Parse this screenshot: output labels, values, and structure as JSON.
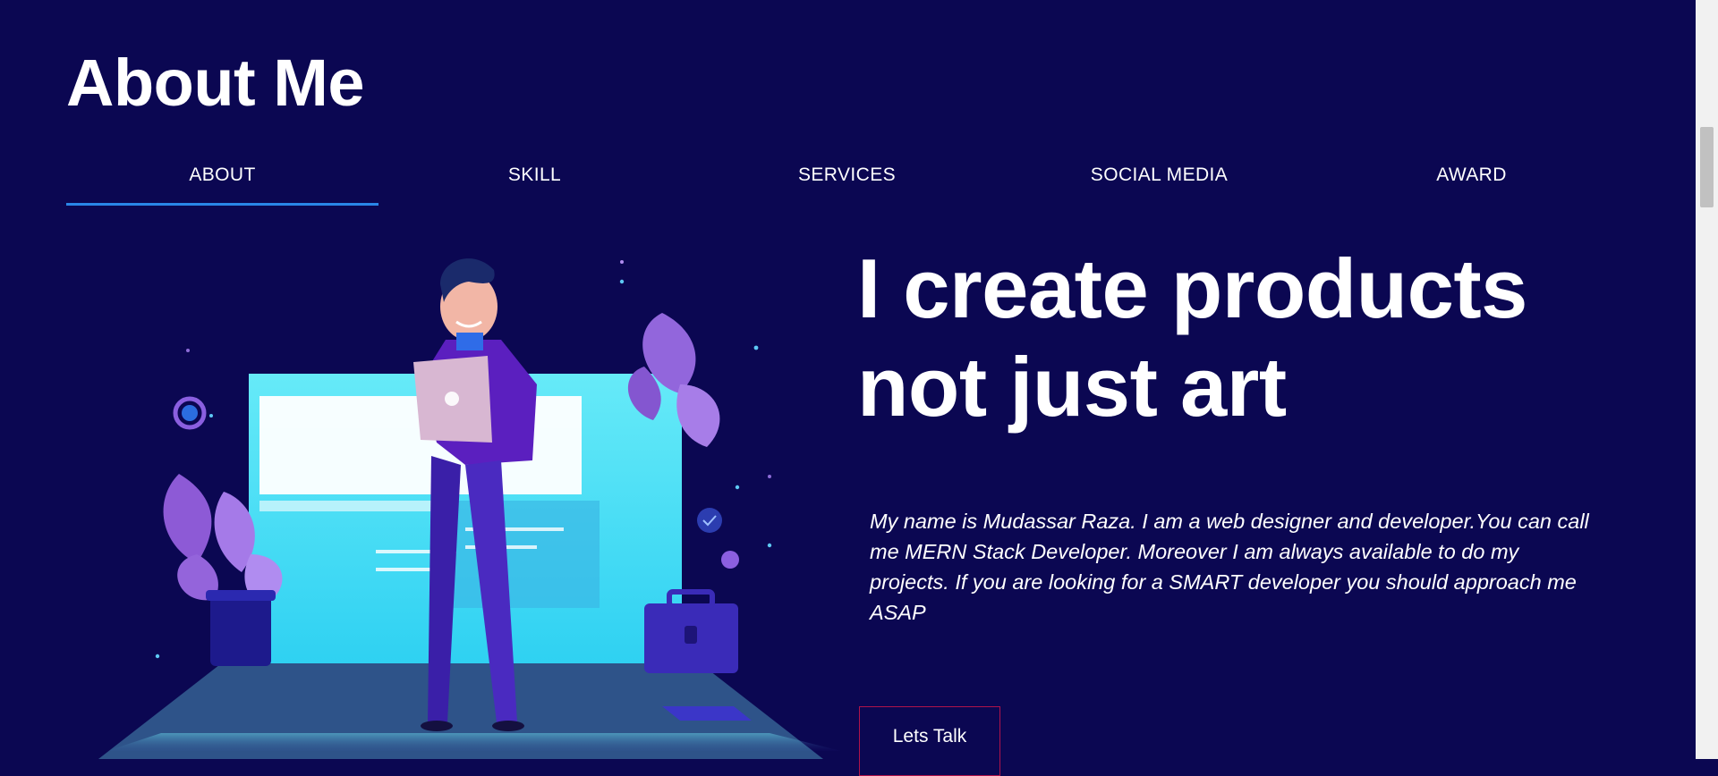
{
  "page": {
    "title": "About Me"
  },
  "tabs": [
    {
      "label": "ABOUT",
      "active": true
    },
    {
      "label": "SKILL",
      "active": false
    },
    {
      "label": "SERVICES",
      "active": false
    },
    {
      "label": "SOCIAL MEDIA",
      "active": false
    },
    {
      "label": "AWARD",
      "active": false
    }
  ],
  "hero": {
    "headline_line1": "I create products",
    "headline_line2": "not just art",
    "bio": "My name is Mudassar Raza. I am a web designer and developer.You can call me MERN Stack Developer. Moreover I am always available to do my projects. If you are looking for a SMART developer you should approach me ASAP",
    "cta_label": "Lets Talk"
  },
  "colors": {
    "background": "#0b0752",
    "tab_underline": "#2a86e8",
    "button_border": "#b0134a",
    "illustration_screen": "#5fe6f7",
    "illustration_leaves": "#8d5ad6"
  },
  "icons": [
    "person-illustration",
    "plant-icon",
    "briefcase-icon",
    "check-badge-icon"
  ]
}
